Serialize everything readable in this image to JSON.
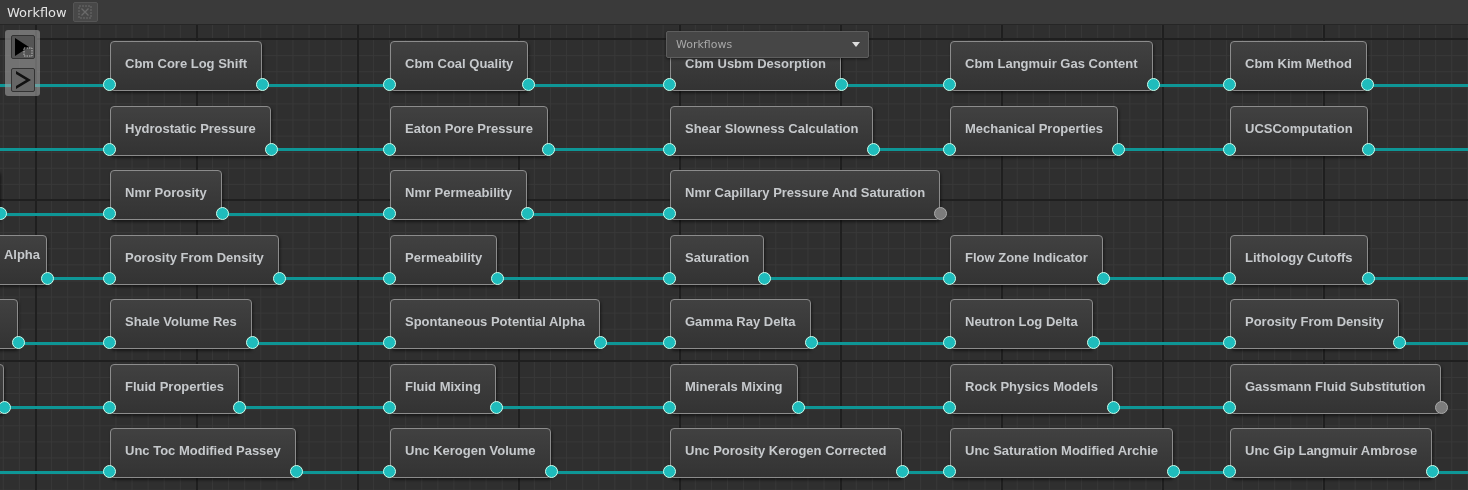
{
  "tab": {
    "title": "Workflow"
  },
  "workflow_selector": {
    "value": "Workflows"
  },
  "rows": [
    {
      "leading": {
        "output_connected": true
      },
      "nodes": [
        {
          "label": "Cbm Core Log Shift",
          "output_connected": true
        },
        {
          "label": "Cbm Coal Quality",
          "output_connected": true
        },
        {
          "label": "Cbm Usbm Desorption",
          "output_connected": true
        },
        {
          "label": "Cbm Langmuir Gas Content",
          "output_connected": true
        },
        {
          "label": "Cbm Kim Method",
          "output_connected": true
        }
      ]
    },
    {
      "leading": {
        "output_connected": true
      },
      "nodes": [
        {
          "label": "Hydrostatic Pressure",
          "output_connected": true
        },
        {
          "label": "Eaton Pore Pressure",
          "output_connected": true
        },
        {
          "label": "Shear Slowness Calculation",
          "output_connected": true
        },
        {
          "label": "Mechanical Properties",
          "output_connected": true
        },
        {
          "label": "UCSComputation",
          "output_connected": true
        }
      ]
    },
    {
      "leading": {
        "output_connected": true
      },
      "nodes": [
        {
          "label": "Nmr Porosity",
          "output_connected": true
        },
        {
          "label": "Nmr Permeability",
          "output_connected": true
        },
        {
          "label": "Nmr Capillary Pressure And Saturation",
          "output_connected": false
        }
      ]
    },
    {
      "leading": {
        "label": "Alpha",
        "output_connected": true
      },
      "nodes": [
        {
          "label": "Porosity From Density",
          "output_connected": true
        },
        {
          "label": "Permeability",
          "output_connected": true
        },
        {
          "label": "Saturation",
          "output_connected": true
        },
        {
          "label": "Flow Zone Indicator",
          "output_connected": true
        },
        {
          "label": "Lithology Cutoffs",
          "output_connected": true
        }
      ]
    },
    {
      "leading": {
        "output_connected": true
      },
      "nodes": [
        {
          "label": "Shale Volume Res",
          "output_connected": true
        },
        {
          "label": "Spontaneous Potential Alpha",
          "output_connected": true
        },
        {
          "label": "Gamma Ray Delta",
          "output_connected": true
        },
        {
          "label": "Neutron Log Delta",
          "output_connected": true
        },
        {
          "label": "Porosity From Density",
          "output_connected": true
        }
      ]
    },
    {
      "leading": {
        "output_connected": true
      },
      "nodes": [
        {
          "label": "Fluid Properties",
          "output_connected": true
        },
        {
          "label": "Fluid Mixing",
          "output_connected": true
        },
        {
          "label": "Minerals Mixing",
          "output_connected": true
        },
        {
          "label": "Rock Physics Models",
          "output_connected": true
        },
        {
          "label": "Gassmann Fluid Substitution",
          "output_connected": false
        }
      ]
    },
    {
      "leading": {
        "output_connected": true
      },
      "nodes": [
        {
          "label": "Unc Toc Modified Passey",
          "output_connected": true
        },
        {
          "label": "Unc Kerogen Volume",
          "output_connected": true
        },
        {
          "label": "Unc Porosity Kerogen Corrected",
          "output_connected": true
        },
        {
          "label": "Unc Saturation Modified Archie",
          "output_connected": true
        },
        {
          "label": "Unc Gip Langmuir Ambrose",
          "output_connected": true
        }
      ]
    }
  ]
}
